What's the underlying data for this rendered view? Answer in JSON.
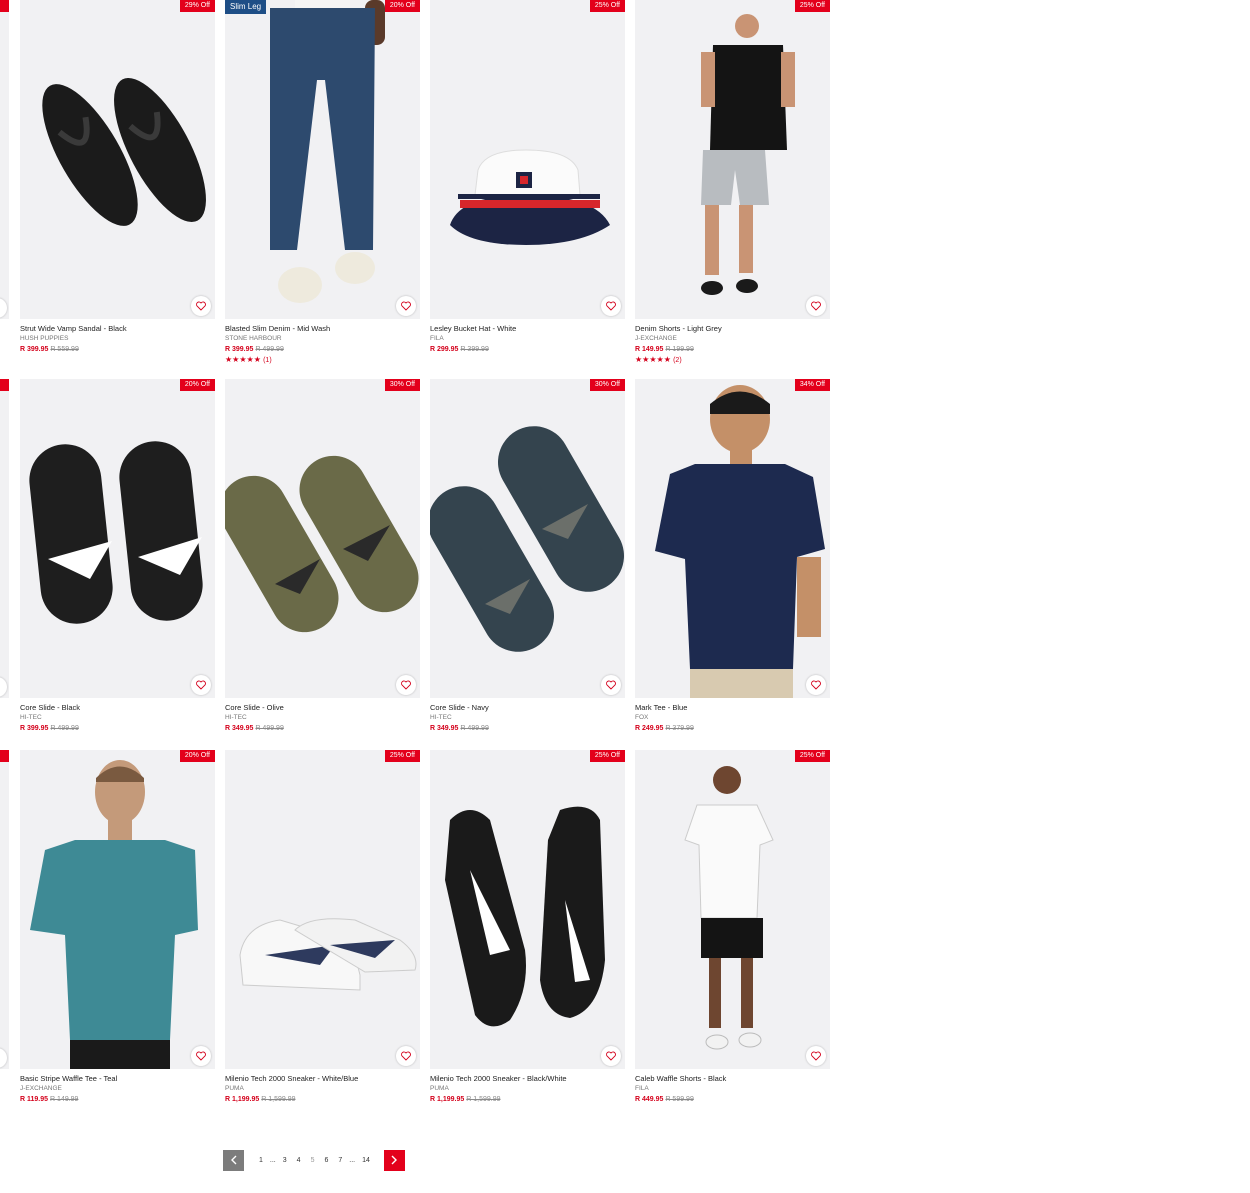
{
  "colors": {
    "accent": "#e3001b",
    "sale_price": "#d4001b",
    "tag_blue": "#1e4e86",
    "card_bg": "#f1f1f3"
  },
  "products": [
    {
      "name": "Strut Wide Vamp Sandal - Black",
      "brand": "HUSH PUPPIES",
      "price": "R 399.95",
      "was": "R 559.99",
      "discount": "29% Off",
      "tag": "",
      "stars": "",
      "reviews": ""
    },
    {
      "name": "Blasted Slim Denim - Mid Wash",
      "brand": "STONE HARBOUR",
      "price": "R 399.95",
      "was": "R 499.99",
      "discount": "20% Off",
      "tag": "Slim Leg",
      "stars": "★★★★★",
      "reviews": "(1)"
    },
    {
      "name": "Lesley Bucket Hat - White",
      "brand": "FILA",
      "price": "R 299.95",
      "was": "R 399.99",
      "discount": "25% Off",
      "tag": "",
      "stars": "",
      "reviews": ""
    },
    {
      "name": "Denim Shorts - Light Grey",
      "brand": "J-EXCHANGE",
      "price": "R 149.95",
      "was": "R 199.99",
      "discount": "25% Off",
      "tag": "",
      "stars": "★★★★★",
      "reviews": "(2)"
    },
    {
      "name": "Core Slide - Black",
      "brand": "HI-TEC",
      "price": "R 399.95",
      "was": "R 499.99",
      "discount": "20% Off",
      "tag": "",
      "stars": "",
      "reviews": ""
    },
    {
      "name": "Core Slide - Olive",
      "brand": "HI-TEC",
      "price": "R 349.95",
      "was": "R 499.99",
      "discount": "30% Off",
      "tag": "",
      "stars": "",
      "reviews": ""
    },
    {
      "name": "Core Slide - Navy",
      "brand": "HI-TEC",
      "price": "R 349.95",
      "was": "R 499.99",
      "discount": "30% Off",
      "tag": "",
      "stars": "",
      "reviews": ""
    },
    {
      "name": "Mark Tee - Blue",
      "brand": "FOX",
      "price": "R 249.95",
      "was": "R 379.99",
      "discount": "34% Off",
      "tag": "",
      "stars": "",
      "reviews": ""
    },
    {
      "name": "Basic Stripe Waffle Tee - Teal",
      "brand": "J-EXCHANGE",
      "price": "R 119.95",
      "was": "R 149.99",
      "discount": "20% Off",
      "tag": "",
      "stars": "",
      "reviews": ""
    },
    {
      "name": "Milenio Tech 2000 Sneaker - White/Blue",
      "brand": "PUMA",
      "price": "R 1,199.95",
      "was": "R 1,599.99",
      "discount": "25% Off",
      "tag": "",
      "stars": "",
      "reviews": ""
    },
    {
      "name": "Milenio Tech 2000 Sneaker - Black/White",
      "brand": "PUMA",
      "price": "R 1,199.95",
      "was": "R 1,599.99",
      "discount": "25% Off",
      "tag": "",
      "stars": "",
      "reviews": ""
    },
    {
      "name": "Caleb Waffle Shorts - Black",
      "brand": "FILA",
      "price": "R 449.95",
      "was": "R 599.99",
      "discount": "25% Off",
      "tag": "",
      "stars": "",
      "reviews": ""
    }
  ],
  "pagination": {
    "prev_icon": "chevron-left-icon",
    "next_icon": "chevron-right-icon",
    "pages": [
      "1",
      "...",
      "3",
      "4",
      "5",
      "6",
      "7",
      "...",
      "14"
    ],
    "current": "5"
  }
}
